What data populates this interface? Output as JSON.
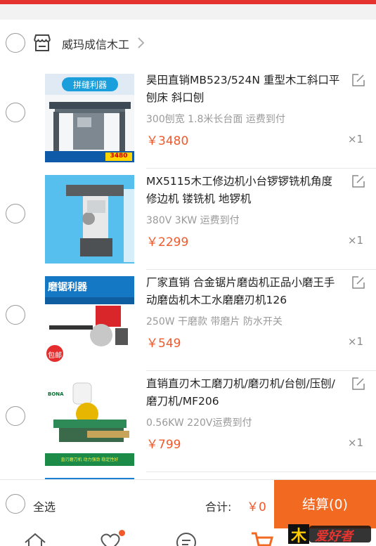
{
  "shop": {
    "name": "威玛成信木工"
  },
  "items": [
    {
      "title": "昊田直销MB523/524N 重型木工斜口平刨床 斜口刨",
      "spec": "300刨宽 1.8米长台面 运费到付",
      "price": "￥3480",
      "qty": "×1",
      "thumb_banner": "拼缝利器",
      "thumb_badge": "3480"
    },
    {
      "title": "MX5115木工修边机小台锣锣铣机角度修边机 镂铣机 地锣机",
      "spec": "380V 3KW 运费到付",
      "price": "￥2299",
      "qty": "×1"
    },
    {
      "title": "厂家直销 合金锯片磨齿机正品小磨王手动磨齿机木工水磨磨刃机126",
      "spec": "250W 干磨款 带磨片 防水开关",
      "price": "￥549",
      "qty": "×1",
      "thumb_banner": "磨锯利器",
      "thumb_badge": "包邮"
    },
    {
      "title": "直销直刃木工磨刀机/磨刃机/台刨/压刨/磨刀机/MF206",
      "spec": "0.56KW 220V运费到付",
      "price": "￥799",
      "qty": "×1",
      "thumb_banner": "直刃磨刀机 动力强劲 稳定性好",
      "thumb_brand": "BONA"
    }
  ],
  "footer": {
    "select_all": "全选",
    "total_label": "合计:",
    "total_value": "￥0",
    "checkout": "结算(0)"
  },
  "watermark": "爱好者",
  "icons": [
    "store-icon",
    "chevron-right-icon",
    "edit-icon",
    "home-icon",
    "heart-pulse-icon",
    "chat-icon",
    "cart-icon"
  ],
  "colors": {
    "accent": "#f26a22",
    "price": "#f0592b",
    "top": "#e4322e"
  }
}
